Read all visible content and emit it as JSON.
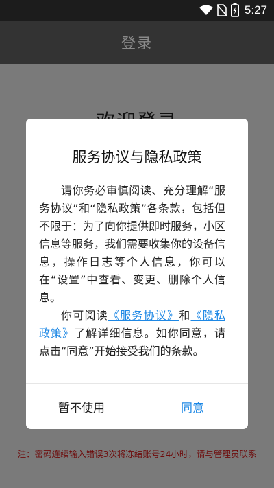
{
  "status_bar": {
    "time": "5:27"
  },
  "app_bar": {
    "title": "登录"
  },
  "background": {
    "welcome": "欢迎登录",
    "notice": "注：密码连续输入错误3次将冻结账号24小时，请与管理员联系"
  },
  "dialog": {
    "title": "服务协议与隐私政策",
    "para1": "请你务必审慎阅读、充分理解“服务协议”和“隐私政策”各条款，包括但不限于：为了向你提供即时服务，小区信息等服务，我们需要收集你的设备信息，操作日志等个人信息，你可以在“设置”中查看、变更、删除个人信息。",
    "para2_prefix": "你可阅读",
    "link_service": "《服务协议》",
    "para2_and": "和",
    "link_privacy": "《隐私政策》",
    "para2_suffix": "了解详细信息。如你同意，请点击“同意”开始接受我们的条款。",
    "cancel_label": "暂不使用",
    "agree_label": "同意"
  },
  "colors": {
    "accent": "#1e88e5",
    "notice": "#6e0c0c",
    "scrim": "#7a7a7a"
  }
}
